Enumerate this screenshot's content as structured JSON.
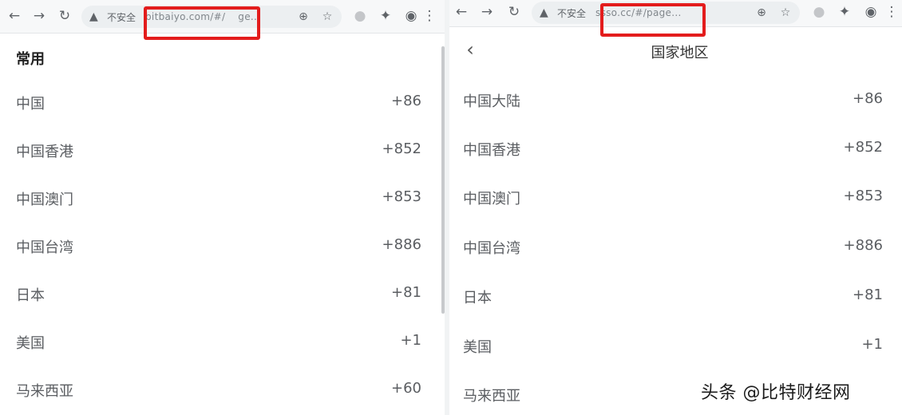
{
  "left": {
    "toolbar": {
      "back_icon": "arrow-left-icon",
      "forward_icon": "arrow-right-icon",
      "reload_icon": "reload-icon",
      "insecure_label": "不安全",
      "url": "bitbaiyo.com/#/",
      "url_suffix": "ge...",
      "zoom_icon": "zoom-icon",
      "star_icon": "star-icon",
      "highlight_color": "#e31c1c"
    },
    "section_title": "常用",
    "items": [
      {
        "name": "中国",
        "code": "+86"
      },
      {
        "name": "中国香港",
        "code": "+852"
      },
      {
        "name": "中国澳门",
        "code": "+853"
      },
      {
        "name": "中国台湾",
        "code": "+886"
      },
      {
        "name": "日本",
        "code": "+81"
      },
      {
        "name": "美国",
        "code": "+1"
      },
      {
        "name": "马来西亚",
        "code": "+60"
      }
    ]
  },
  "right": {
    "toolbar": {
      "insecure_label": "不安全",
      "url": "ssso.cc/#/page...",
      "highlight_color": "#e31c1c"
    },
    "page_title": "国家地区",
    "items": [
      {
        "name": "中国大陆",
        "code": "+86"
      },
      {
        "name": "中国香港",
        "code": "+852"
      },
      {
        "name": "中国澳门",
        "code": "+853"
      },
      {
        "name": "中国台湾",
        "code": "+886"
      },
      {
        "name": "日本",
        "code": "+81"
      },
      {
        "name": "美国",
        "code": "+1"
      },
      {
        "name": "马来西亚",
        "code": ""
      }
    ]
  },
  "watermark": "头条 @比特财经网"
}
